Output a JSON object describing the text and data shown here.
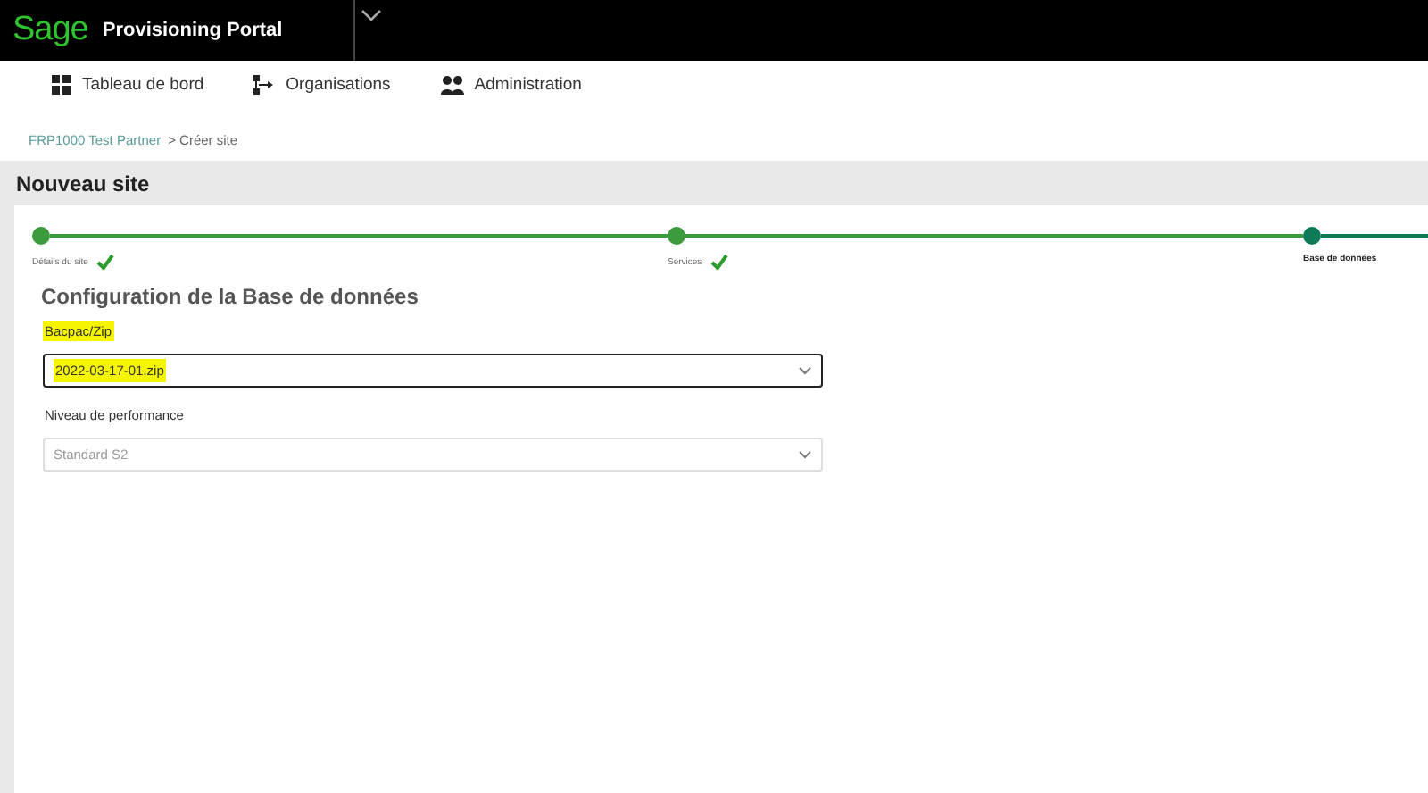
{
  "header": {
    "logo": "Sage",
    "title": "Provisioning Portal"
  },
  "nav": [
    {
      "label": "Tableau de bord",
      "kind": "grid"
    },
    {
      "label": "Organisations",
      "kind": "hierarchy"
    },
    {
      "label": "Administration",
      "kind": "users"
    }
  ],
  "breadcrumb": {
    "link": "FRP1000 Test Partner",
    "current": "> Créer site"
  },
  "page_title": "Nouveau site",
  "steps": [
    {
      "label": "Détails du site",
      "completed": true,
      "selected": false
    },
    {
      "label": "Services",
      "completed": true,
      "selected": false
    },
    {
      "label": "Base de données",
      "completed": false,
      "selected": true
    }
  ],
  "section_title": "Configuration de la Base de données",
  "fields": [
    {
      "label": "Bacpac/Zip",
      "value": "2022-03-17-01.zip",
      "disabled": false,
      "highlighted": true
    },
    {
      "label": "Niveau de performance",
      "value": "Standard S2",
      "disabled": true,
      "highlighted": false
    }
  ]
}
